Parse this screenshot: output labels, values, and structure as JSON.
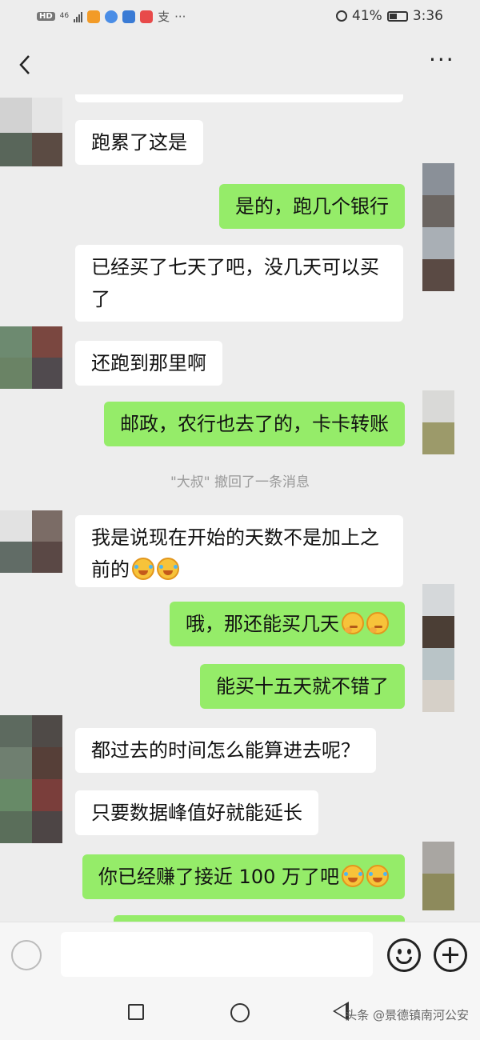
{
  "status_bar": {
    "hd": "HD",
    "network": "46",
    "battery": "41%",
    "time": "3:36",
    "icons": [
      "video-app-icon",
      "browser-app-icon",
      "shield-app-icon",
      "mail-app-icon",
      "alipay-icon",
      "more-notifications-icon"
    ]
  },
  "title_bar": {
    "more": "···"
  },
  "messages": [
    {
      "side": "left",
      "text": "跑累了这是"
    },
    {
      "side": "right",
      "text": "是的，跑几个银行"
    },
    {
      "side": "left",
      "text": "已经买了七天了吧，没几天可以买了"
    },
    {
      "side": "left",
      "text": "还跑到那里啊"
    },
    {
      "side": "right",
      "text": "邮政，农行也去了的，卡卡转账"
    },
    {
      "side": "left",
      "text": "我是说现在开始的天数不是加上之前的",
      "emoji": "laugh-cry-emoji x2"
    },
    {
      "side": "right",
      "text": "哦，那还能买几天",
      "emoji": "smirk-emoji x2"
    },
    {
      "side": "right",
      "text": "能买十五天就不错了"
    },
    {
      "side": "left",
      "text": "都过去的时间怎么能算进去呢？"
    },
    {
      "side": "left",
      "text": "只要数据峰值好就能延长"
    },
    {
      "side": "right",
      "text": "你已经赚了接近 100 万了吧",
      "emoji": "laugh-cry-emoji x2"
    }
  ],
  "recall_notice": "\"大叔\" 撤回了一条消息",
  "input": {
    "value": ""
  },
  "watermark": "头条 @景德镇南河公安",
  "colors": {
    "background": "#ededed",
    "sent_bubble": "#95ec69",
    "received_bubble": "#ffffff"
  }
}
